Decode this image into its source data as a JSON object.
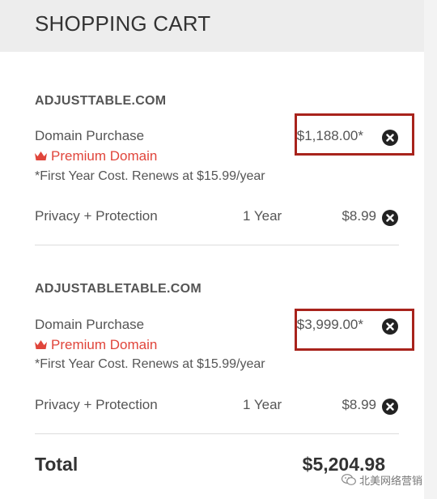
{
  "header": {
    "title": "SHOPPING CART"
  },
  "items": [
    {
      "domain": "ADJUSTTABLE.COM",
      "purchase_label": "Domain Purchase",
      "purchase_price": "$1,188.00*",
      "premium_label": "Premium Domain",
      "note": "*First Year Cost. Renews at $15.99/year",
      "privacy_label": "Privacy + Protection",
      "privacy_term": "1 Year",
      "privacy_price": "$8.99"
    },
    {
      "domain": "ADJUSTABLETABLE.COM",
      "purchase_label": "Domain Purchase",
      "purchase_price": "$3,999.00*",
      "premium_label": "Premium Domain",
      "note": "*First Year Cost. Renews at $15.99/year",
      "privacy_label": "Privacy + Protection",
      "privacy_term": "1 Year",
      "privacy_price": "$8.99"
    }
  ],
  "total": {
    "label": "Total",
    "value": "$5,204.98"
  },
  "watermark": "北美网络营销",
  "colors": {
    "premium": "#e0453b",
    "highlight_box": "#a8231c"
  },
  "icons": [
    "crown-icon",
    "close-circle-icon",
    "wechat-icon"
  ]
}
